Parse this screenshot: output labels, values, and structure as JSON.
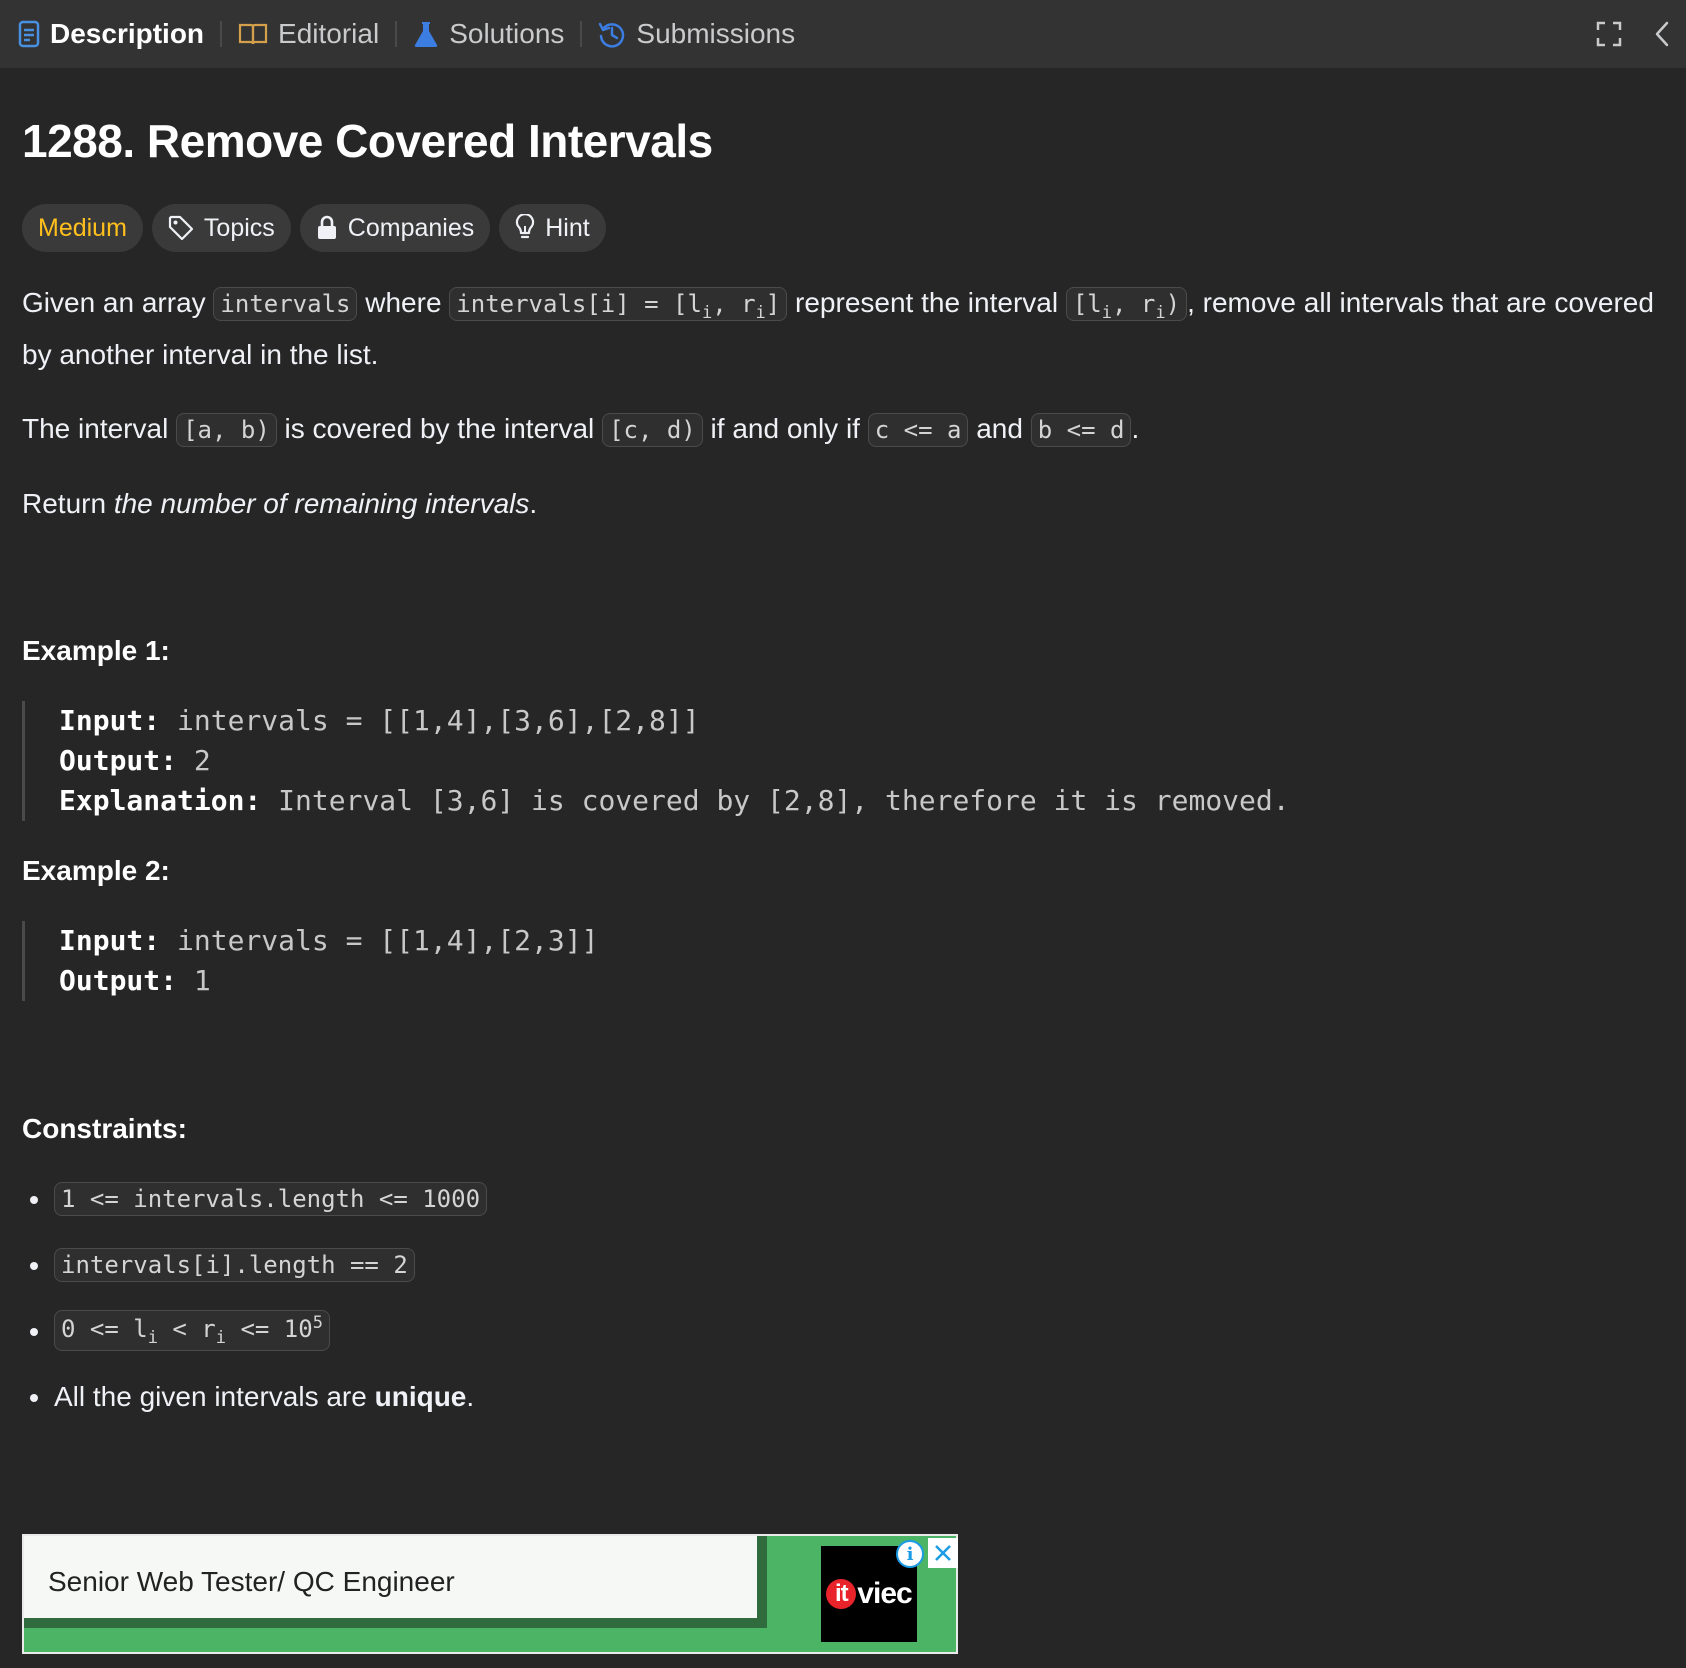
{
  "tabs": [
    {
      "label": "Description",
      "icon": "document-icon",
      "color": "#4a90e2"
    },
    {
      "label": "Editorial",
      "icon": "book-icon",
      "color": "#d4a04c"
    },
    {
      "label": "Solutions",
      "icon": "flask-icon",
      "color": "#3b7de0"
    },
    {
      "label": "Submissions",
      "icon": "history-icon",
      "color": "#3b7de0"
    }
  ],
  "problem": {
    "title": "1288. Remove Covered Intervals",
    "difficulty": "Medium",
    "tags": {
      "topics": "Topics",
      "companies": "Companies",
      "hint": "Hint"
    },
    "desc1": {
      "a": "Given an array ",
      "code1": "intervals",
      "b": " where ",
      "code2_pre": "intervals[i] = [l",
      "code2_sub1": "i",
      "code2_mid": ", r",
      "code2_sub2": "i",
      "code2_post": "]",
      "c": " represent the interval ",
      "code3_pre": "[l",
      "code3_sub1": "i",
      "code3_mid": ", r",
      "code3_sub2": "i",
      "code3_post": ")",
      "d": ", remove all intervals that are covered by another interval in the list."
    },
    "desc2": {
      "a": "The interval ",
      "code1": "[a, b)",
      "b": " is covered by the interval ",
      "code2": "[c, d)",
      "c": " if and only if ",
      "code3": "c <= a",
      "d": " and ",
      "code4": "b <= d",
      "e": "."
    },
    "desc3": {
      "a": "Return ",
      "em": "the number of remaining intervals",
      "b": "."
    },
    "examples": [
      {
        "heading": "Example 1:",
        "input_label": "Input:",
        "input": "intervals = [[1,4],[3,6],[2,8]]",
        "output_label": "Output:",
        "output": "2",
        "explanation_label": "Explanation:",
        "explanation": "Interval [3,6] is covered by [2,8], therefore it is removed."
      },
      {
        "heading": "Example 2:",
        "input_label": "Input:",
        "input": "intervals = [[1,4],[2,3]]",
        "output_label": "Output:",
        "output": "1"
      }
    ],
    "constraints_heading": "Constraints:",
    "constraints": {
      "c1": "1 <= intervals.length <= 1000",
      "c2": "intervals[i].length == 2",
      "c3_pre": "0 <= l",
      "c3_sub1": "i",
      "c3_mid": " < r",
      "c3_sub2": "i",
      "c3_post": " <= 10",
      "c3_sup": "5",
      "c4_a": "All the given intervals are ",
      "c4_b": "unique",
      "c4_c": "."
    }
  },
  "ad": {
    "title": "Senior Web Tester/ QC Engineer",
    "logo_it": "it",
    "logo_rest": "viec",
    "info_glyph": "i"
  }
}
